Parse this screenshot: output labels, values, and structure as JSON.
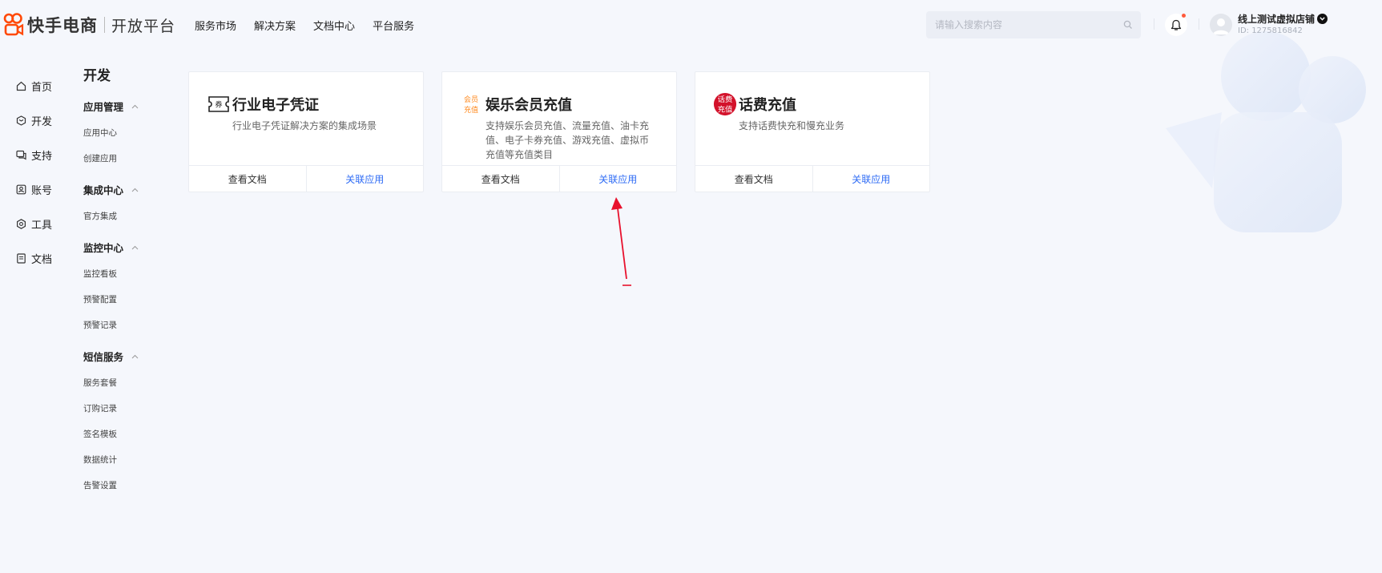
{
  "header": {
    "brand": "快手电商",
    "brand_sub": "开放平台",
    "nav": [
      "服务市场",
      "解决方案",
      "文档中心",
      "平台服务"
    ],
    "search_placeholder": "请输入搜索内容",
    "user_name": "线上测试虚拟店铺",
    "user_id": "ID: 1275816842"
  },
  "leftnav": [
    {
      "label": "首页",
      "icon": "home-icon"
    },
    {
      "label": "开发",
      "icon": "cube-icon"
    },
    {
      "label": "支持",
      "icon": "chat-icon"
    },
    {
      "label": "账号",
      "icon": "account-icon"
    },
    {
      "label": "工具",
      "icon": "gear-icon"
    },
    {
      "label": "文档",
      "icon": "document-icon"
    }
  ],
  "submenu": {
    "title": "开发",
    "groups": [
      {
        "label": "应用管理",
        "items": [
          "应用中心",
          "创建应用"
        ]
      },
      {
        "label": "集成中心",
        "items": [
          "官方集成"
        ]
      },
      {
        "label": "监控中心",
        "items": [
          "监控看板",
          "预警配置",
          "预警记录"
        ]
      },
      {
        "label": "短信服务",
        "items": [
          "服务套餐",
          "订购记录",
          "签名模板",
          "数据统计",
          "告警设置"
        ]
      }
    ]
  },
  "cards": [
    {
      "title": "行业电子凭证",
      "desc": "行业电子凭证解决方案的集成场景",
      "icon_text": "券",
      "docs": "查看文档",
      "link": "关联应用"
    },
    {
      "title": "娱乐会员充值",
      "desc": "支持娱乐会员充值、流量充值、油卡充值、电子卡券充值、游戏充值、虚拟币充值等充值类目",
      "icon_text_1": "会员",
      "icon_text_2": "充值",
      "docs": "查看文档",
      "link": "关联应用"
    },
    {
      "title": "话费充值",
      "desc": "支持话费快充和慢充业务",
      "icon_text_1": "话费",
      "icon_text_2": "充值",
      "docs": "查看文档",
      "link": "关联应用"
    }
  ],
  "colors": {
    "accent": "#2f6cf5",
    "brand": "#ff4906",
    "annotation": "#e8112d"
  }
}
